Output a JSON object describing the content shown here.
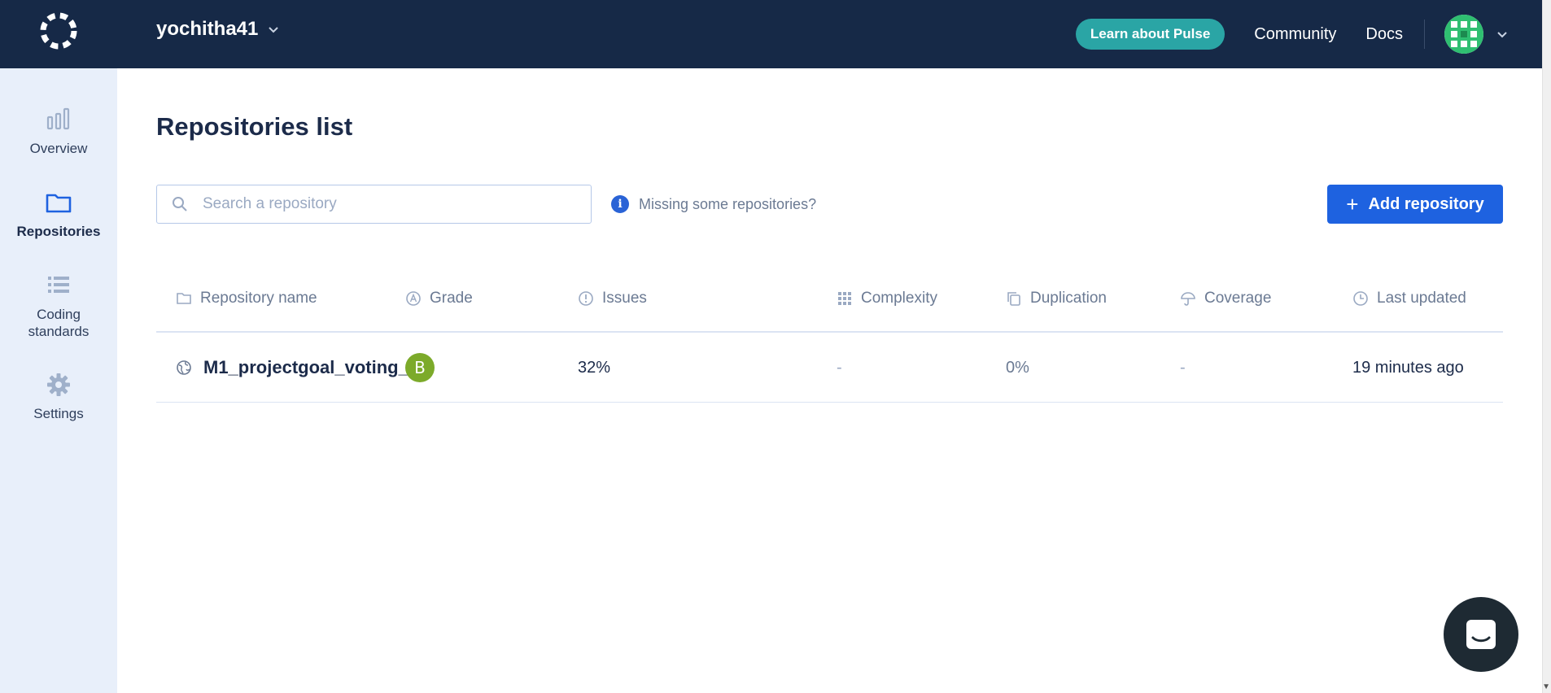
{
  "header": {
    "org_name": "yochitha41",
    "pulse_label": "Learn about Pulse",
    "community_label": "Community",
    "docs_label": "Docs"
  },
  "sidebar": {
    "items": [
      {
        "label": "Overview",
        "icon": "bar-chart-icon",
        "active": false
      },
      {
        "label": "Repositories",
        "icon": "folder-icon",
        "active": true
      },
      {
        "label": "Coding standards",
        "icon": "list-icon",
        "active": false
      },
      {
        "label": "Settings",
        "icon": "gear-icon",
        "active": false
      }
    ]
  },
  "main": {
    "title": "Repositories list",
    "search": {
      "placeholder": "Search a repository",
      "value": ""
    },
    "missing_text": "Missing some repositories?",
    "add_button_label": "Add repository"
  },
  "table": {
    "columns": [
      "Repository name",
      "Grade",
      "Issues",
      "Complexity",
      "Duplication",
      "Coverage",
      "Last updated"
    ],
    "rows": [
      {
        "name": "M1_projectgoal_voting_…",
        "grade": "B",
        "issues": "32%",
        "complexity": "-",
        "duplication": "0%",
        "coverage": "-",
        "last_updated": "19 minutes ago"
      }
    ]
  },
  "colors": {
    "header_bg": "#162947",
    "pulse_teal": "#2aa5a5",
    "primary_blue": "#1e62e0",
    "grade_b": "#7caa2a",
    "sidebar_bg": "#e8effa"
  }
}
